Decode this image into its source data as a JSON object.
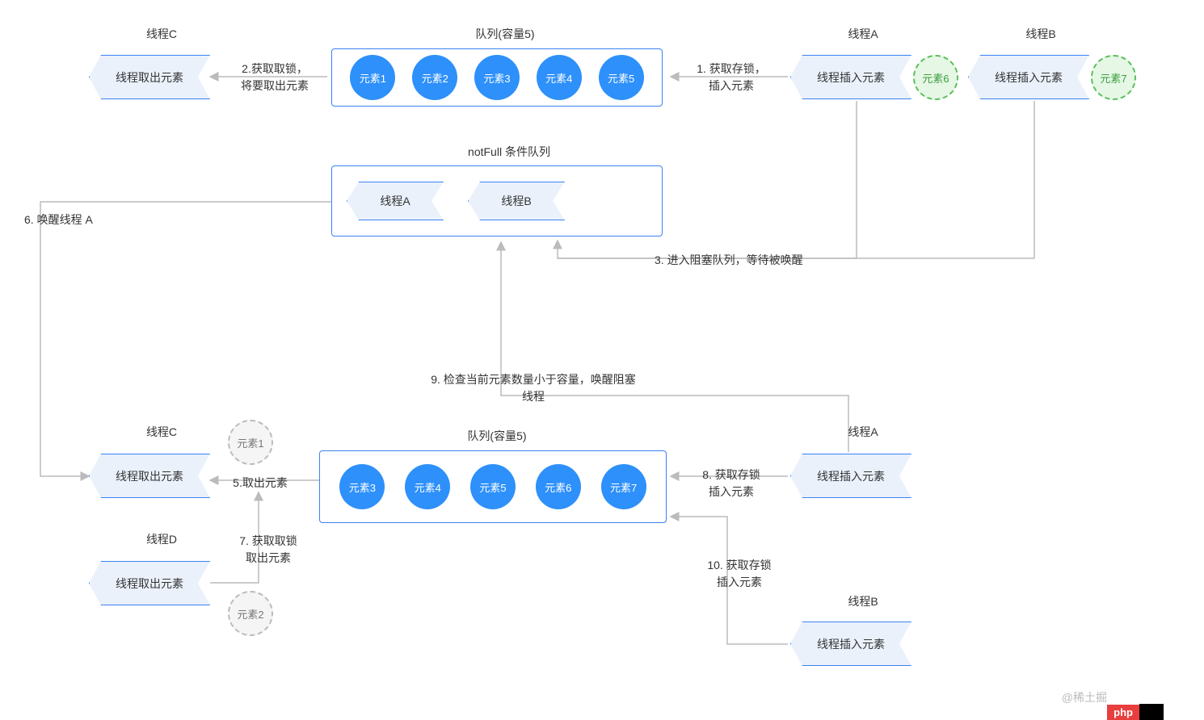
{
  "top": {
    "threadC": {
      "title": "线程C",
      "block": "线程取出元素"
    },
    "threadA": {
      "title": "线程A",
      "block": "线程插入元素"
    },
    "threadB": {
      "title": "线程B",
      "block": "线程插入元素"
    },
    "queueTitle": "队列(容量5)",
    "queue": [
      "元素1",
      "元素2",
      "元素3",
      "元素4",
      "元素5"
    ],
    "element6": "元素6",
    "element7": "元素7",
    "label1": "1. 获取存锁，\n插入元素",
    "label2": "2.获取取锁，\n将要取出元素"
  },
  "notFull": {
    "title": "notFull 条件队列",
    "items": [
      "线程A",
      "线程B"
    ],
    "label3": "3. 进入阻塞队列，等待被唤醒",
    "label6": "6. 唤醒线程 A"
  },
  "bottom": {
    "threadC": {
      "title": "线程C",
      "block": "线程取出元素"
    },
    "threadD": {
      "title": "线程D",
      "block": "线程取出元素"
    },
    "threadA": {
      "title": "线程A",
      "block": "线程插入元素"
    },
    "threadB": {
      "title": "线程B",
      "block": "线程插入元素"
    },
    "queueTitle": "队列(容量5)",
    "queue": [
      "元素3",
      "元素4",
      "元素5",
      "元素6",
      "元素7"
    ],
    "grayEl1": "元素1",
    "grayEl2": "元素2",
    "label5": "5.取出元素",
    "label7": "7. 获取取锁\n取出元素",
    "label8": "8. 获取存锁\n插入元素",
    "label9": "9. 检查当前元素数量小于容量，唤醒阻塞\n线程",
    "label10": "10. 获取存锁\n插入元素"
  },
  "watermark": "@稀土掘"
}
